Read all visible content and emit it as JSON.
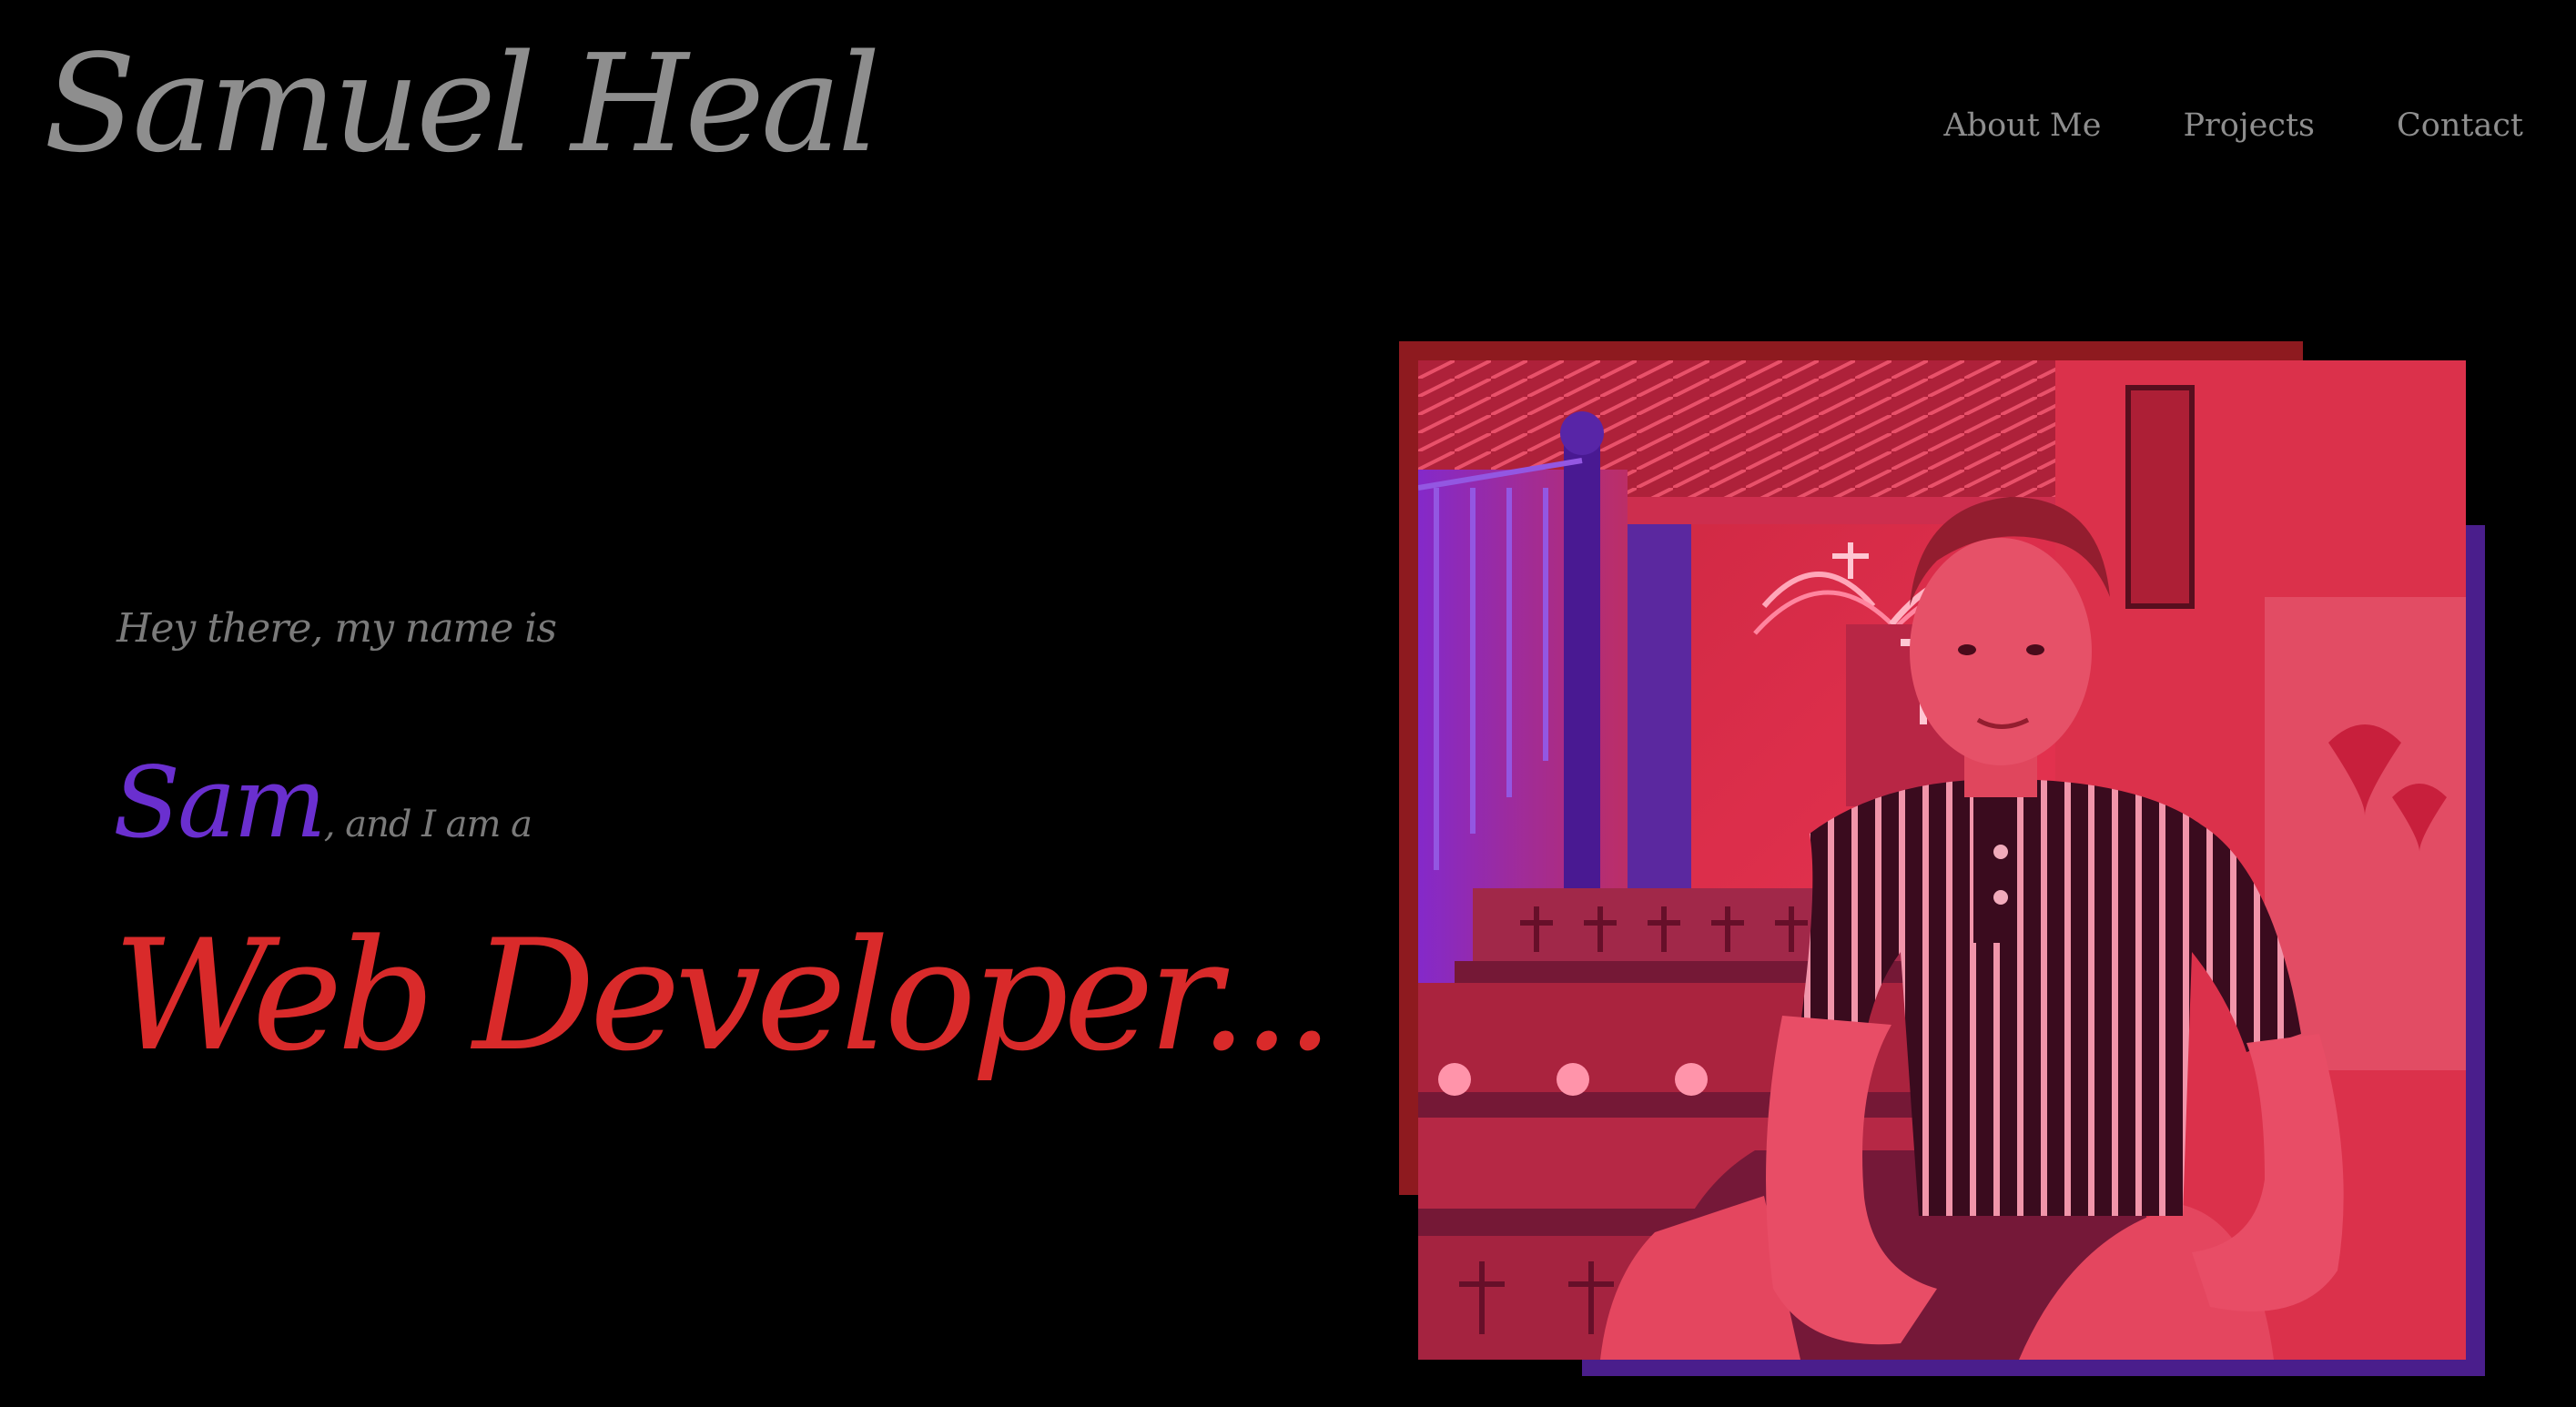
{
  "header": {
    "logo_text": "Samuel Heal",
    "nav": [
      {
        "label": "About Me"
      },
      {
        "label": "Projects"
      },
      {
        "label": "Contact"
      }
    ]
  },
  "hero": {
    "intro": "Hey there, my name is",
    "name": "Sam",
    "name_suffix": ", and I am a",
    "role": "Web Developer..."
  },
  "colors": {
    "background": "#000000",
    "muted_text": "#8e8e8e",
    "accent_purple": "#6a2fcf",
    "accent_red": "#d92a2a",
    "frame_red": "#8e1a1f",
    "frame_purple": "#4a1e8c"
  }
}
